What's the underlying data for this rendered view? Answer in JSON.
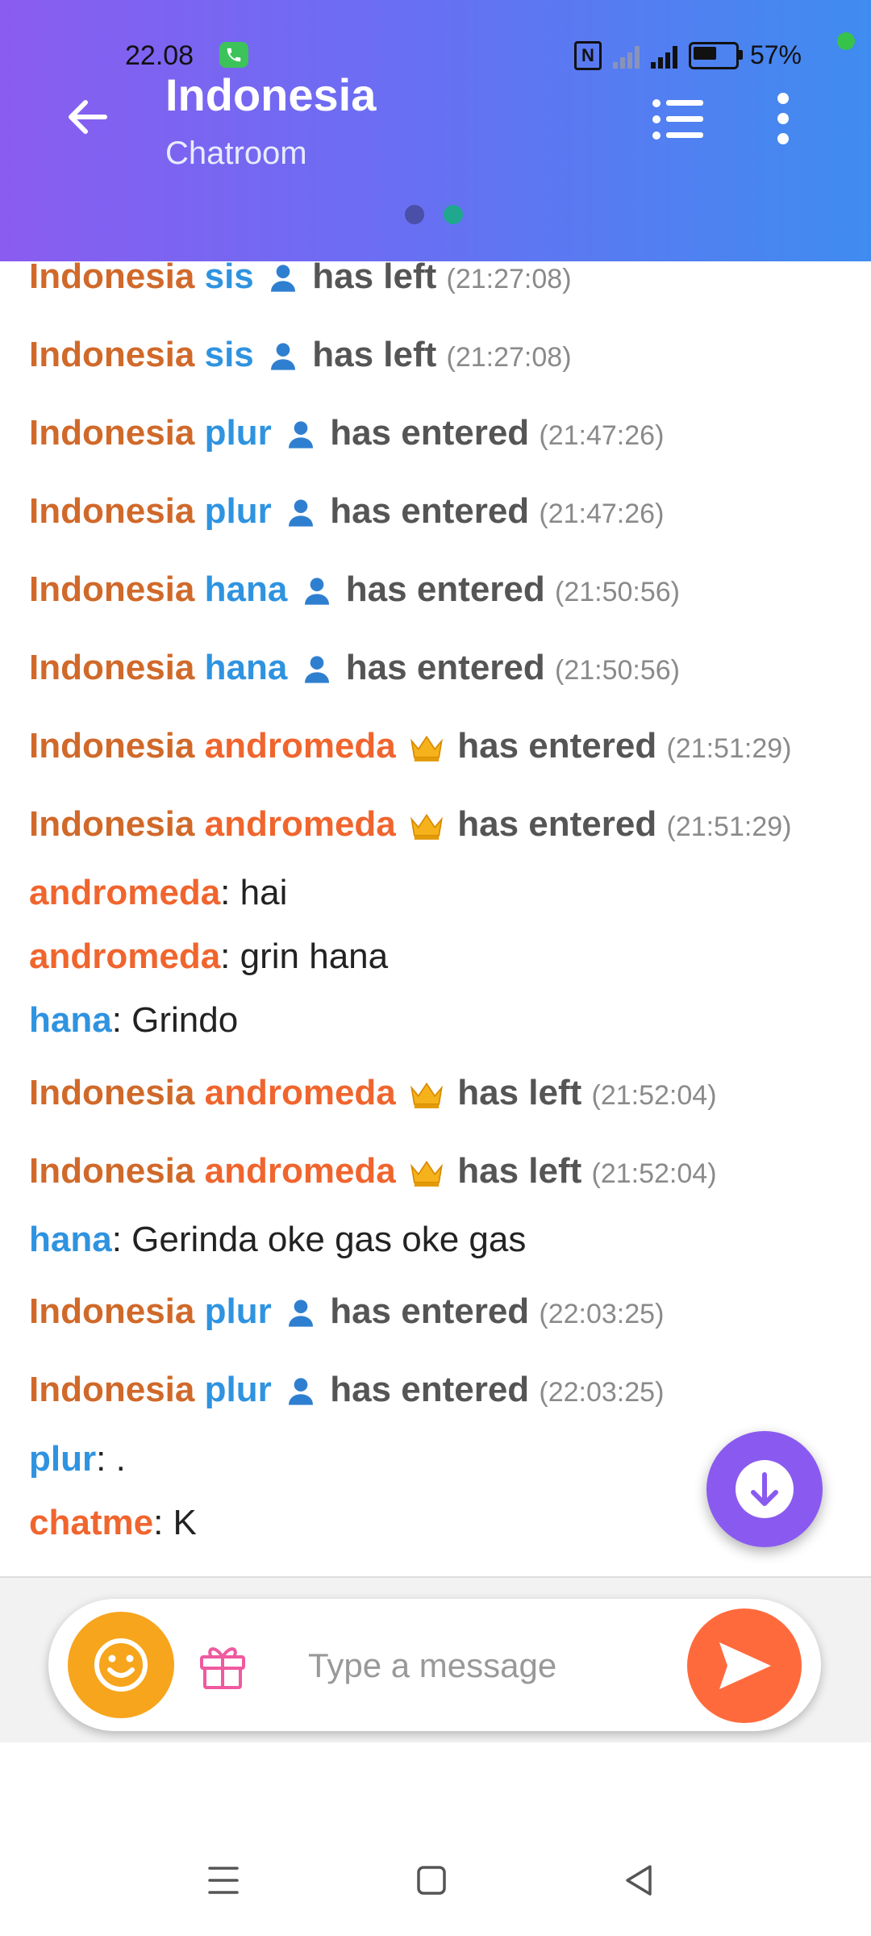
{
  "status_bar": {
    "time": "22.08",
    "battery": "57%",
    "network": "4G"
  },
  "header": {
    "title": "Indonesia",
    "subtitle": "Chatroom"
  },
  "colors": {
    "header_start": "#8a5cf0",
    "header_end": "#3f8cf0",
    "room": "#d0692a",
    "user_blue": "#2f93e0",
    "user_orange": "#f0652e",
    "fab": "#8a5af0",
    "emoji_btn": "#f7a51c",
    "send_btn": "#ff6a3d"
  },
  "events": [
    {
      "room": "Indonesia",
      "user": "sis",
      "role": "user",
      "action": "has left",
      "time": "(21:27:08)"
    },
    {
      "room": "Indonesia",
      "user": "sis",
      "role": "user",
      "action": "has left",
      "time": "(21:27:08)"
    },
    {
      "room": "Indonesia",
      "user": "plur",
      "role": "user",
      "action": "has entered",
      "time": "(21:47:26)"
    },
    {
      "room": "Indonesia",
      "user": "plur",
      "role": "user",
      "action": "has entered",
      "time": "(21:47:26)"
    },
    {
      "room": "Indonesia",
      "user": "hana",
      "role": "user",
      "action": "has entered",
      "time": "(21:50:56)"
    },
    {
      "room": "Indonesia",
      "user": "hana",
      "role": "user",
      "action": "has entered",
      "time": "(21:50:56)"
    },
    {
      "room": "Indonesia",
      "user": "andromeda",
      "role": "crown",
      "action": "has entered",
      "time": "(21:51:29)"
    },
    {
      "room": "Indonesia",
      "user": "andromeda",
      "role": "crown",
      "action": "has entered",
      "time": "(21:51:29)"
    },
    {
      "room": "Indonesia",
      "user": "andromeda",
      "role": "crown",
      "action": "has left",
      "time": "(21:52:04)"
    },
    {
      "room": "Indonesia",
      "user": "andromeda",
      "role": "crown",
      "action": "has left",
      "time": "(21:52:04)"
    },
    {
      "room": "Indonesia",
      "user": "plur",
      "role": "user",
      "action": "has entered",
      "time": "(22:03:25)"
    },
    {
      "room": "Indonesia",
      "user": "plur",
      "role": "user",
      "action": "has entered",
      "time": "(22:03:25)"
    }
  ],
  "messages": [
    {
      "user": "andromeda",
      "sep": ": ",
      "text": "hai"
    },
    {
      "user": "andromeda",
      "sep": ": ",
      "text": "grin hana"
    },
    {
      "user": "hana",
      "sep": ": ",
      "text": "Grindo"
    },
    {
      "user": "hana",
      "sep": ": ",
      "text": "Gerinda oke gas oke gas"
    },
    {
      "user": "plur",
      "sep": ": ",
      "text": "."
    },
    {
      "user": "chatme",
      "sep": ": ",
      "text": "K"
    }
  ],
  "composer": {
    "placeholder": "Type a message"
  },
  "icons": {
    "back": "arrow-left-icon",
    "list": "list-icon",
    "more": "more-vertical-icon",
    "scroll_down": "arrow-down-circle-icon",
    "emoji": "smiley-icon",
    "gift": "gift-icon",
    "send": "send-icon",
    "user": "person-icon",
    "crown": "crown-icon"
  }
}
